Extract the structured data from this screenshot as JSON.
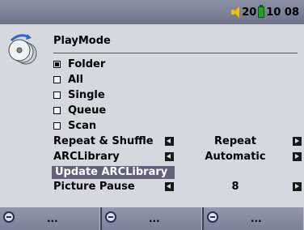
{
  "status": {
    "volume": "20",
    "time": "10 08"
  },
  "header": {
    "title": "PlayMode"
  },
  "play_modes": [
    {
      "label": "Folder",
      "checked": true
    },
    {
      "label": "All",
      "checked": false
    },
    {
      "label": "Single",
      "checked": false
    },
    {
      "label": "Queue",
      "checked": false
    },
    {
      "label": "Scan",
      "checked": false
    }
  ],
  "settings": {
    "repeat_shuffle": {
      "label": "Repeat & Shuffle",
      "value": "Repeat"
    },
    "arclibrary": {
      "label": "ARCLibrary",
      "value": "Automatic"
    },
    "update_label": "Update ARCLibrary",
    "picture_pause": {
      "label": "Picture Pause",
      "value": "8"
    }
  },
  "softkeys": [
    {
      "label": "..."
    },
    {
      "label": "..."
    },
    {
      "label": "..."
    }
  ],
  "colors": {
    "top_bar": "#7e8299",
    "background": "#d6d8e0",
    "selected_item": "#5f637b",
    "battery": "#1aa51a",
    "speaker": "#f3c000"
  }
}
